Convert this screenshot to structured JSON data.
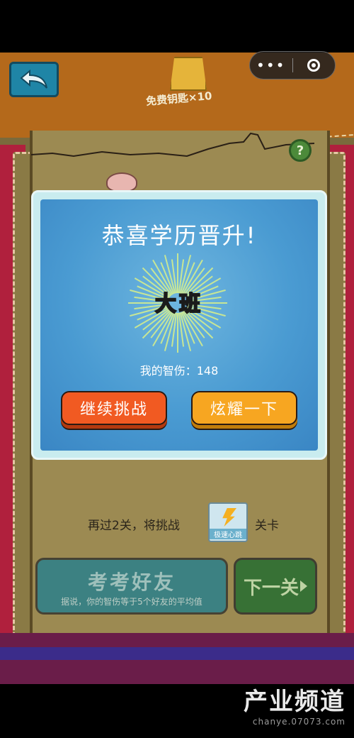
{
  "header": {
    "key_reward": "免费钥匙×10"
  },
  "capsule": {
    "more": "•••"
  },
  "help": {
    "label": "?"
  },
  "modal": {
    "title": "恭喜学历晋升!",
    "rank": "大班",
    "score_label": "我的智伤：148",
    "continue_label": "继续挑战",
    "show_off_label": "炫耀一下"
  },
  "unlock": {
    "prefix": "再过2关，将挑战",
    "badge_label": "极速心跳",
    "suffix": "关卡"
  },
  "challenge_friends": {
    "title": "考考好友",
    "subtitle": "据说，你的智伤等于5个好友的平均值"
  },
  "next_level": {
    "label": "下一关"
  },
  "watermark": {
    "brand": "产业频道",
    "url": "chanye.07073.com"
  },
  "colors": {
    "modal_bg": "#4a9bd2",
    "continue_btn": "#f15a22",
    "show_off_btn": "#f7a621",
    "back_btn": "#1f85a6"
  }
}
